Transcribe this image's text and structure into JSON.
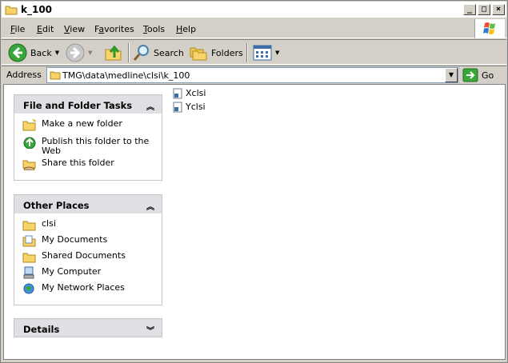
{
  "window": {
    "title": "k_100"
  },
  "menu": [
    {
      "pre": "",
      "u": "F",
      "post": "ile"
    },
    {
      "pre": "",
      "u": "E",
      "post": "dit"
    },
    {
      "pre": "",
      "u": "V",
      "post": "iew"
    },
    {
      "pre": "F",
      "u": "a",
      "post": "vorites"
    },
    {
      "pre": "",
      "u": "T",
      "post": "ools"
    },
    {
      "pre": "",
      "u": "H",
      "post": "elp"
    }
  ],
  "toolbar": {
    "back_label": "Back",
    "search_label": "Search",
    "folders_label": "Folders"
  },
  "address": {
    "label": "Address",
    "value": "TMG\\data\\medline\\clsi\\k_100",
    "go_label": "Go"
  },
  "tasks": {
    "file_folder": {
      "title": "File and Folder Tasks",
      "items": [
        "Make a new folder",
        "Publish this folder to the Web",
        "Share this folder"
      ]
    },
    "other_places": {
      "title": "Other Places",
      "items": [
        "clsi",
        "My Documents",
        "Shared Documents",
        "My Computer",
        "My Network Places"
      ]
    },
    "details": {
      "title": "Details"
    }
  },
  "files": [
    "Xclsi",
    "Yclsi"
  ]
}
